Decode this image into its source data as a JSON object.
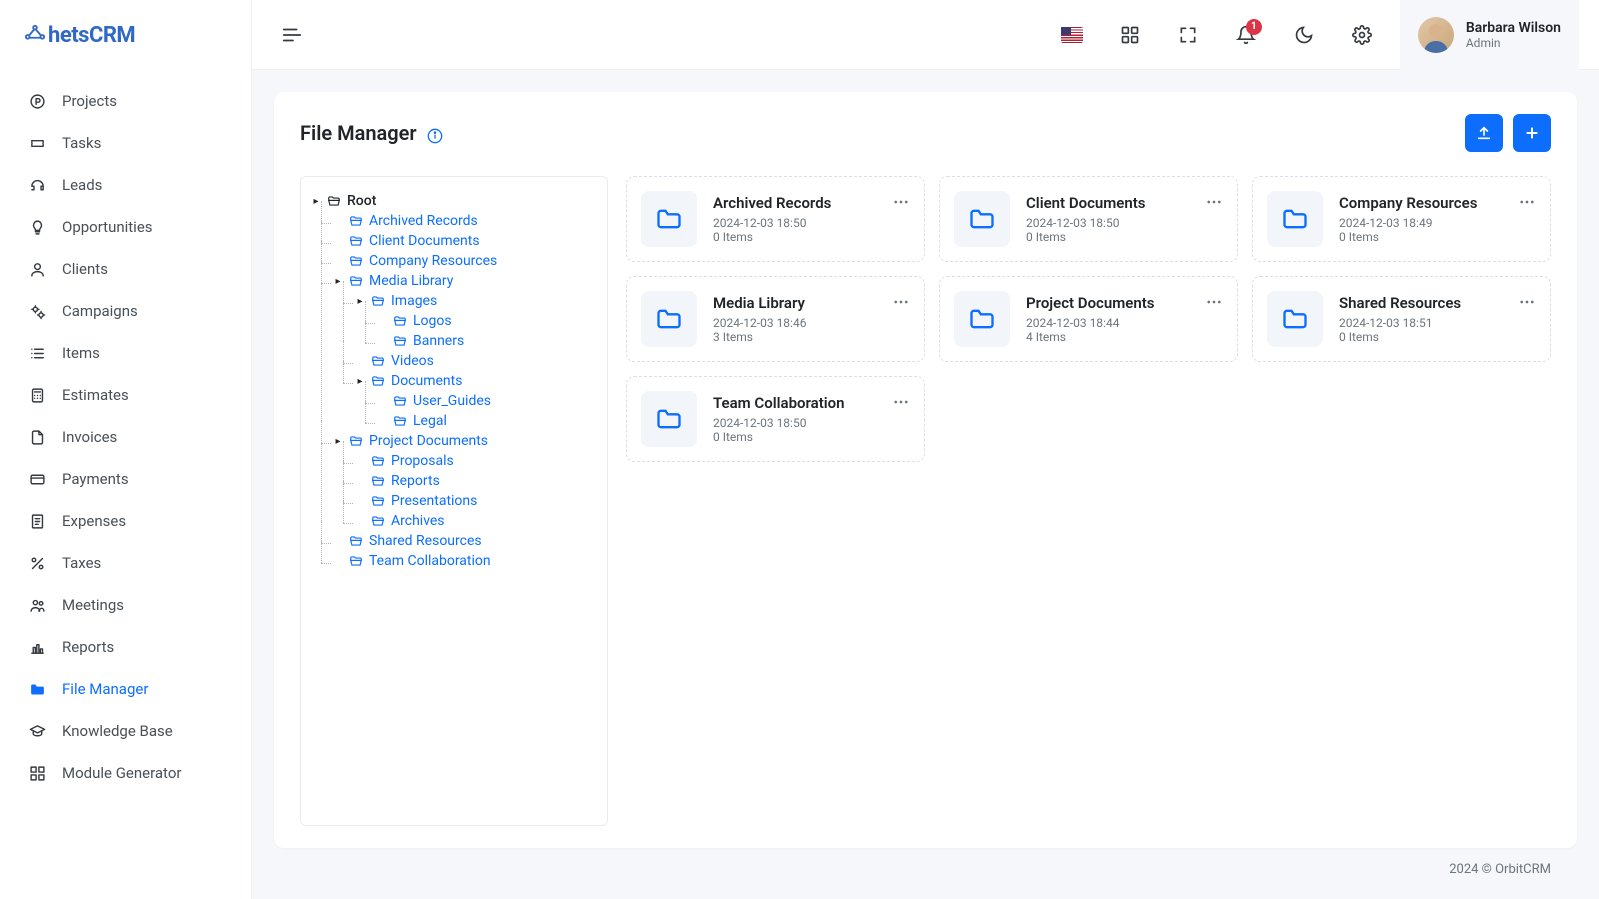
{
  "brand": {
    "name": "hetsCRM"
  },
  "user": {
    "name": "Barbara Wilson",
    "role": "Admin"
  },
  "notifications": {
    "count": 1
  },
  "sidebar": {
    "items": [
      {
        "label": "Projects",
        "icon": "p-circle"
      },
      {
        "label": "Tasks",
        "icon": "ticket"
      },
      {
        "label": "Leads",
        "icon": "headset"
      },
      {
        "label": "Opportunities",
        "icon": "bulb"
      },
      {
        "label": "Clients",
        "icon": "person"
      },
      {
        "label": "Campaigns",
        "icon": "gears"
      },
      {
        "label": "Items",
        "icon": "list"
      },
      {
        "label": "Estimates",
        "icon": "calculator"
      },
      {
        "label": "Invoices",
        "icon": "file"
      },
      {
        "label": "Payments",
        "icon": "card"
      },
      {
        "label": "Expenses",
        "icon": "receipt"
      },
      {
        "label": "Taxes",
        "icon": "percent"
      },
      {
        "label": "Meetings",
        "icon": "people"
      },
      {
        "label": "Reports",
        "icon": "chart"
      },
      {
        "label": "File Manager",
        "icon": "folder",
        "active": true
      },
      {
        "label": "Knowledge Base",
        "icon": "graduation"
      },
      {
        "label": "Module Generator",
        "icon": "grid"
      }
    ]
  },
  "page": {
    "title": "File Manager"
  },
  "tree": {
    "root": "Root",
    "children": [
      {
        "label": "Archived Records"
      },
      {
        "label": "Client Documents"
      },
      {
        "label": "Company Resources"
      },
      {
        "label": "Media Library",
        "expandable": true,
        "children": [
          {
            "label": "Images",
            "expandable": true,
            "children": [
              {
                "label": "Logos"
              },
              {
                "label": "Banners"
              }
            ]
          },
          {
            "label": "Videos"
          },
          {
            "label": "Documents",
            "expandable": true,
            "children": [
              {
                "label": "User_Guides"
              },
              {
                "label": "Legal"
              }
            ]
          }
        ]
      },
      {
        "label": "Project Documents",
        "expandable": true,
        "children": [
          {
            "label": "Proposals"
          },
          {
            "label": "Reports"
          },
          {
            "label": "Presentations"
          },
          {
            "label": "Archives"
          }
        ]
      },
      {
        "label": "Shared Resources"
      },
      {
        "label": "Team Collaboration"
      }
    ]
  },
  "folders": [
    {
      "name": "Archived Records",
      "date": "2024-12-03 18:50",
      "items": "0 Items"
    },
    {
      "name": "Client Documents",
      "date": "2024-12-03 18:50",
      "items": "0 Items"
    },
    {
      "name": "Company Resources",
      "date": "2024-12-03 18:49",
      "items": "0 Items"
    },
    {
      "name": "Media Library",
      "date": "2024-12-03 18:46",
      "items": "3 Items"
    },
    {
      "name": "Project Documents",
      "date": "2024-12-03 18:44",
      "items": "4 Items"
    },
    {
      "name": "Shared Resources",
      "date": "2024-12-03 18:51",
      "items": "0 Items"
    },
    {
      "name": "Team Collaboration",
      "date": "2024-12-03 18:50",
      "items": "0 Items"
    }
  ],
  "footer": {
    "text": "2024 © OrbitCRM"
  }
}
